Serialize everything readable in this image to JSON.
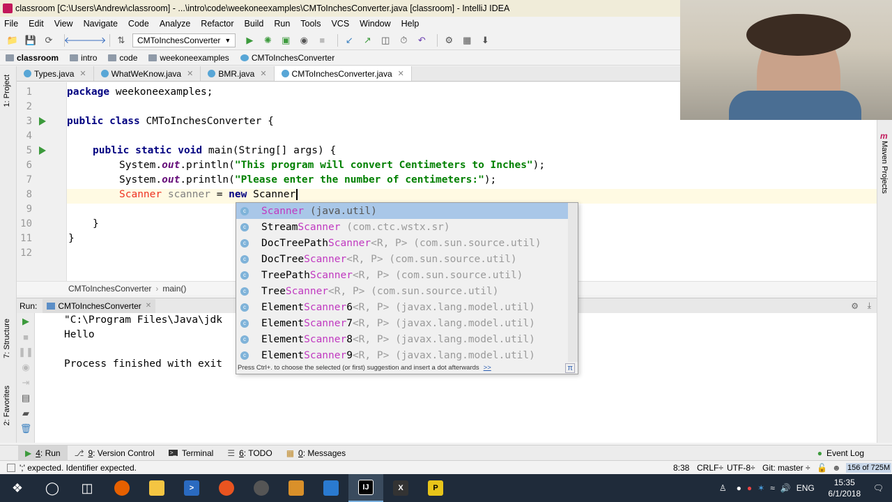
{
  "window": {
    "title": "classroom [C:\\Users\\Andrew\\classroom] - ...\\intro\\code\\weekoneexamples\\CMToInchesConverter.java [classroom] - IntelliJ IDEA"
  },
  "menu": [
    "File",
    "Edit",
    "View",
    "Navigate",
    "Code",
    "Analyze",
    "Refactor",
    "Build",
    "Run",
    "Tools",
    "VCS",
    "Window",
    "Help"
  ],
  "toolbar": {
    "run_config": "CMToInchesConverter"
  },
  "breadcrumbs": [
    "classroom",
    "intro",
    "code",
    "weekoneexamples",
    "CMToInchesConverter"
  ],
  "tabs": [
    "Types.java",
    "WhatWeKnow.java",
    "BMR.java",
    "CMToInchesConverter.java"
  ],
  "left_strip": {
    "project": "1: Project",
    "structure": "7: Structure",
    "favorites": "2: Favorites"
  },
  "right_strip": {
    "maven": "Maven Projects"
  },
  "editor": {
    "line_numbers": [
      "1",
      "2",
      "3",
      "4",
      "5",
      "6",
      "7",
      "8",
      "9",
      "10",
      "11",
      "12"
    ],
    "lines": {
      "l1_kw": "package",
      "l1_rest": " weekoneexamples;",
      "l3_kw": "public class",
      "l3_rest": " CMToInchesConverter {",
      "l5_kw": "public static void",
      "l5_rest": " main(String[] args) {",
      "l6_pre": "System.",
      "l6_field": "out",
      "l6_mid": ".println(",
      "l6_str": "\"This program will convert Centimeters to Inches\"",
      "l6_end": ");",
      "l7_pre": "System.",
      "l7_field": "out",
      "l7_mid": ".println(",
      "l7_str": "\"Please enter the number of centimeters:\"",
      "l7_end": ");",
      "l8_type": "Scanner",
      "l8_var": " scanner ",
      "l8_eq": "= ",
      "l8_kw": "new",
      "l8_rest": " Scanner",
      "l10": "}",
      "l11": "}"
    },
    "crumbs": [
      "CMToInchesConverter",
      "main()"
    ]
  },
  "completion": {
    "items": [
      {
        "pre": "",
        "match": "Scanner",
        "post": "",
        "generic": "",
        "pkg": " (java.util)"
      },
      {
        "pre": "Stream",
        "match": "Scanner",
        "post": "",
        "generic": "",
        "pkg": " (com.ctc.wstx.sr)"
      },
      {
        "pre": "DocTreePath",
        "match": "Scanner",
        "post": "",
        "generic": "<R, P>",
        "pkg": " (com.sun.source.util)"
      },
      {
        "pre": "DocTree",
        "match": "Scanner",
        "post": "",
        "generic": "<R, P>",
        "pkg": " (com.sun.source.util)"
      },
      {
        "pre": "TreePath",
        "match": "Scanner",
        "post": "",
        "generic": "<R, P>",
        "pkg": " (com.sun.source.util)"
      },
      {
        "pre": "Tree",
        "match": "Scanner",
        "post": "",
        "generic": "<R, P>",
        "pkg": " (com.sun.source.util)"
      },
      {
        "pre": "Element",
        "match": "Scanner",
        "post": "6",
        "generic": "<R, P>",
        "pkg": " (javax.lang.model.util)"
      },
      {
        "pre": "Element",
        "match": "Scanner",
        "post": "7",
        "generic": "<R, P>",
        "pkg": " (javax.lang.model.util)"
      },
      {
        "pre": "Element",
        "match": "Scanner",
        "post": "8",
        "generic": "<R, P>",
        "pkg": " (javax.lang.model.util)"
      },
      {
        "pre": "Element",
        "match": "Scanner",
        "post": "9",
        "generic": "<R, P>",
        "pkg": " (javax.lang.model.util)"
      }
    ],
    "hint": "Press Ctrl+. to choose the selected (or first) suggestion and insert a dot afterwards",
    "more": ">>",
    "pi": "π"
  },
  "run": {
    "label": "Run:",
    "tab": "CMToInchesConverter",
    "console": [
      "\"C:\\Program Files\\Java\\jdk",
      "Hello",
      "",
      "Process finished with exit"
    ]
  },
  "bottom_tools": [
    {
      "num": "4",
      "label": ": Run"
    },
    {
      "num": "9",
      "label": ": Version Control"
    },
    {
      "num": "",
      "label": "Terminal"
    },
    {
      "num": "6",
      "label": ": TODO"
    },
    {
      "num": "0",
      "label": ": Messages"
    }
  ],
  "event_log": "Event Log",
  "status": {
    "message": "';' expected. Identifier expected.",
    "position": "8:38",
    "line_sep": "CRLF÷",
    "encoding": "UTF-8÷",
    "git": "Git: master ÷",
    "memory": "156 of 725M"
  },
  "taskbar": {
    "lang": "ENG",
    "time": "15:35",
    "date": "6/1/2018"
  },
  "colors": {
    "keyword": "#000080",
    "string": "#008000",
    "match": "#c039c0",
    "selection": "#a9c7e8"
  }
}
